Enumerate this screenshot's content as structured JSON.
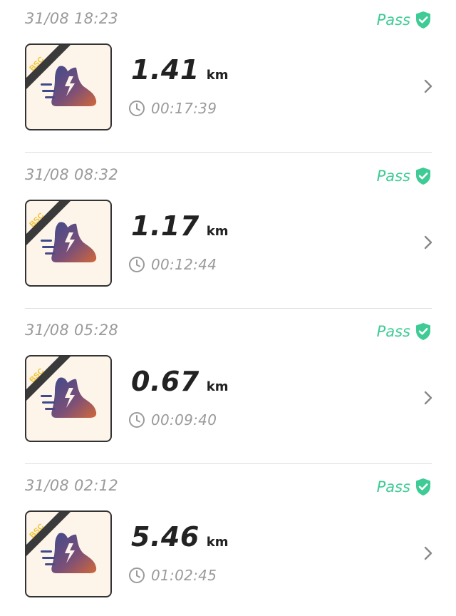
{
  "status_color": "#3ecb95",
  "records": [
    {
      "datetime": "31/08 18:23",
      "status": "Pass",
      "badge": "BSC",
      "distance": "1.41",
      "unit": "km",
      "duration": "00:17:39"
    },
    {
      "datetime": "31/08 08:32",
      "status": "Pass",
      "badge": "BSC",
      "distance": "1.17",
      "unit": "km",
      "duration": "00:12:44"
    },
    {
      "datetime": "31/08 05:28",
      "status": "Pass",
      "badge": "BSC",
      "distance": "0.67",
      "unit": "km",
      "duration": "00:09:40"
    },
    {
      "datetime": "31/08 02:12",
      "status": "Pass",
      "badge": "BSC",
      "distance": "5.46",
      "unit": "km",
      "duration": "01:02:45"
    }
  ],
  "icons": {
    "status": "shield-check-icon",
    "thumbnail": "running-shoe-icon",
    "duration": "clock-icon",
    "open": "chevron-right-icon"
  }
}
